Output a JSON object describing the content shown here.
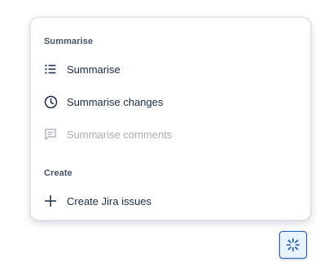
{
  "menu": {
    "sections": [
      {
        "heading": "Summarise",
        "items": [
          {
            "label": "Summarise",
            "icon": "list-icon",
            "disabled": false
          },
          {
            "label": "Summarise changes",
            "icon": "clock-icon",
            "disabled": false
          },
          {
            "label": "Summarise comments",
            "icon": "comment-icon",
            "disabled": true
          }
        ]
      },
      {
        "heading": "Create",
        "items": [
          {
            "label": "Create Jira issues",
            "icon": "plus-icon",
            "disabled": false
          }
        ]
      }
    ]
  },
  "fab": {
    "icon": "ai-sparkle-icon"
  },
  "colors": {
    "text": "#172b4d",
    "heading": "#44546f",
    "disabled": "#a5adba",
    "accent": "#1d5fc4"
  }
}
